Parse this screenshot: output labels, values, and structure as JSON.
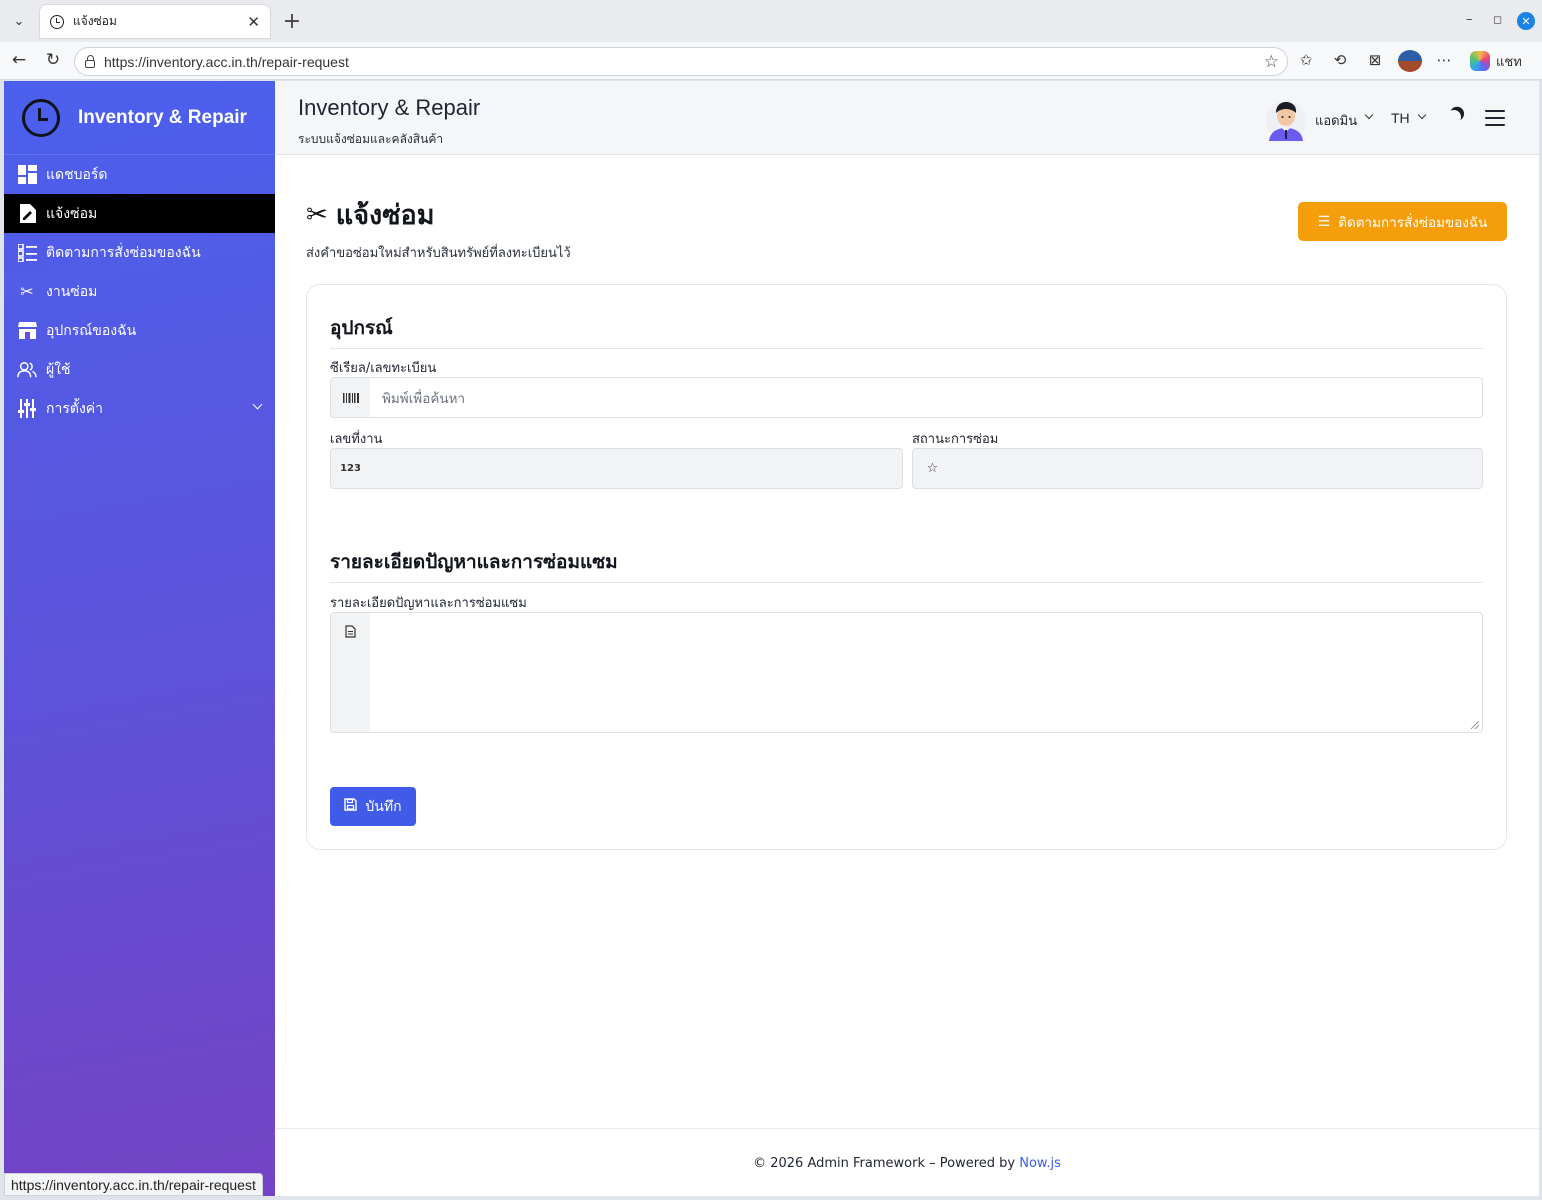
{
  "browser": {
    "tab_title": "แจ้งซ่อม",
    "url": "https://inventory.acc.in.th/repair-request",
    "copilot_label": "แชท",
    "status_url": "https://inventory.acc.in.th/repair-request"
  },
  "sidebar": {
    "brand": "Inventory & Repair",
    "items": [
      {
        "label": "แดชบอร์ด",
        "icon": "dashboard-icon",
        "active": false
      },
      {
        "label": "แจ้งซ่อม",
        "icon": "repair-request-icon",
        "active": true
      },
      {
        "label": "ติดตามการสั่งซ่อมของฉัน",
        "icon": "checklist-icon",
        "active": false
      },
      {
        "label": "งานซ่อม",
        "icon": "tools-icon",
        "active": false
      },
      {
        "label": "อุปกรณ์ของฉัน",
        "icon": "store-icon",
        "active": false
      },
      {
        "label": "ผู้ใช้",
        "icon": "users-icon",
        "active": false
      },
      {
        "label": "การตั้งค่า",
        "icon": "sliders-icon",
        "active": false
      }
    ]
  },
  "header": {
    "title": "Inventory & Repair",
    "subtitle": "ระบบแจ้งซ่อมและคลังสินค้า",
    "user_name": "แอดมิน",
    "language": "TH"
  },
  "page": {
    "title": "แจ้งซ่อม",
    "description": "ส่งคำขอซ่อมใหม่สำหรับสินทรัพย์ที่ลงทะเบียนไว้",
    "track_button": "ติดตามการสั่งซ่อมของฉัน"
  },
  "form": {
    "section_equipment": "อุปกรณ์",
    "serial_label": "ซีเรียล/เลขทะเบียน",
    "serial_placeholder": "พิมพ์เพื่อค้นหา",
    "job_no_label": "เลขที่งาน",
    "job_no_value": "",
    "status_label": "สถานะการซ่อม",
    "status_value": "",
    "section_details": "รายละเอียดปัญหาและการซ่อมแซม",
    "details_label": "รายละเอียดปัญหาและการซ่อมแซม",
    "details_value": "",
    "save_button": "บันทึก"
  },
  "footer": {
    "text": "© 2026 Admin Framework – Powered by ",
    "link": "Now.js"
  },
  "colors": {
    "accent": "#3f5be8",
    "warning": "#f59e0b",
    "sidebar_top": "#4b60ee",
    "sidebar_bottom": "#7442c4",
    "active_item": "#000000"
  }
}
